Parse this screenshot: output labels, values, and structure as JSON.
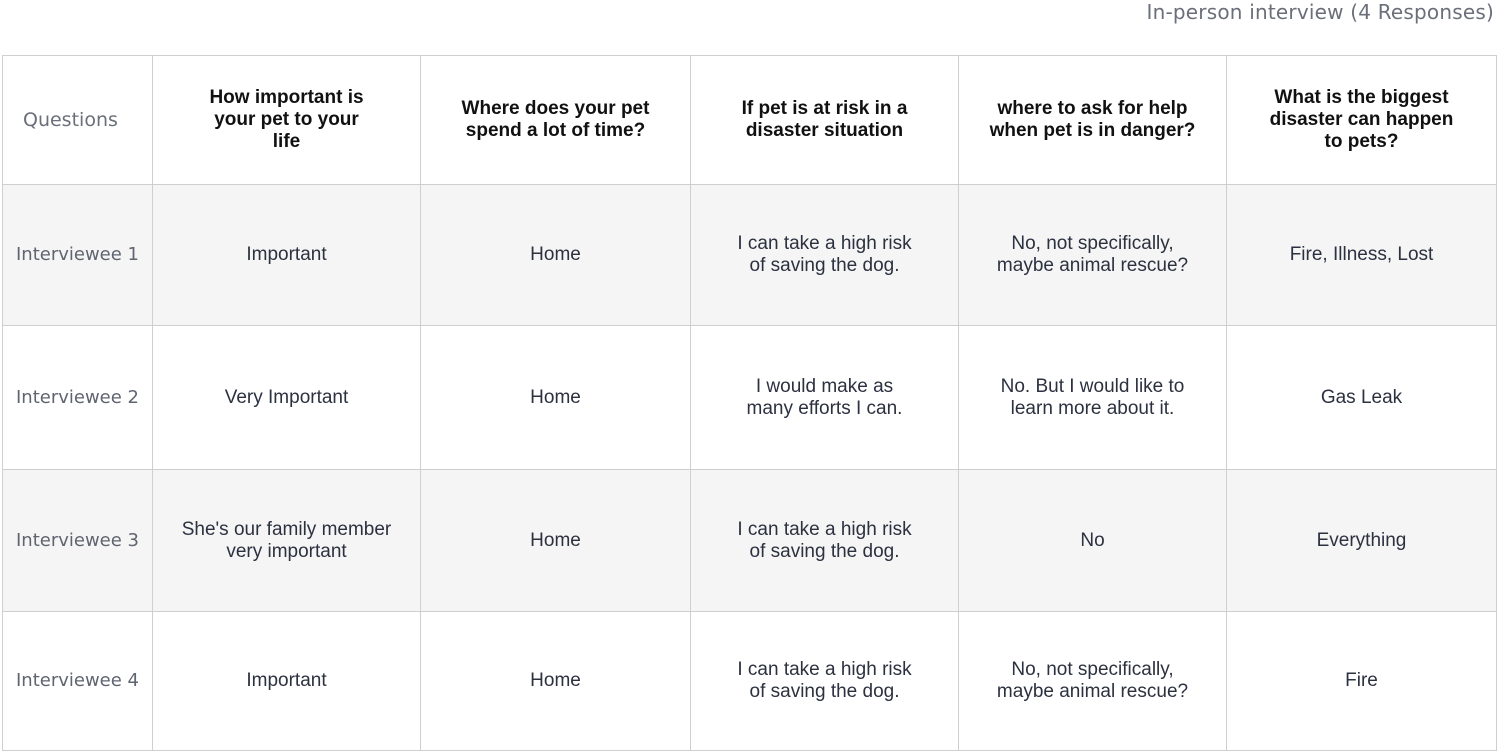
{
  "title": "In-person interview (4 Responses)",
  "header": {
    "row_label": "Questions",
    "questions": [
      "How important is your pet to your life",
      "Where does your pet spend a lot of time?",
      "If pet is at risk in a disaster situation",
      "where to ask for help when pet is in danger?",
      "What is the biggest disaster can happen to pets?"
    ]
  },
  "rows": [
    {
      "label": "Interviewee 1",
      "answers": [
        "Important",
        "Home",
        "I can take a high risk of saving the dog.",
        "No, not specifically, maybe animal rescue?",
        "Fire, Illness, Lost"
      ]
    },
    {
      "label": "Interviewee 2",
      "answers": [
        "Very Important",
        "Home",
        "I would make as many efforts I can.",
        "No. But I would like to learn more about it.",
        "Gas Leak"
      ]
    },
    {
      "label": "Interviewee 3",
      "answers": [
        "She's our family member very important",
        "Home",
        "I can take a high risk of saving the dog.",
        "No",
        "Everything"
      ]
    },
    {
      "label": "Interviewee 4",
      "answers": [
        "Important",
        "Home",
        "I can take a high risk of saving the dog.",
        "No, not specifically, maybe animal rescue?",
        "Fire"
      ]
    }
  ]
}
